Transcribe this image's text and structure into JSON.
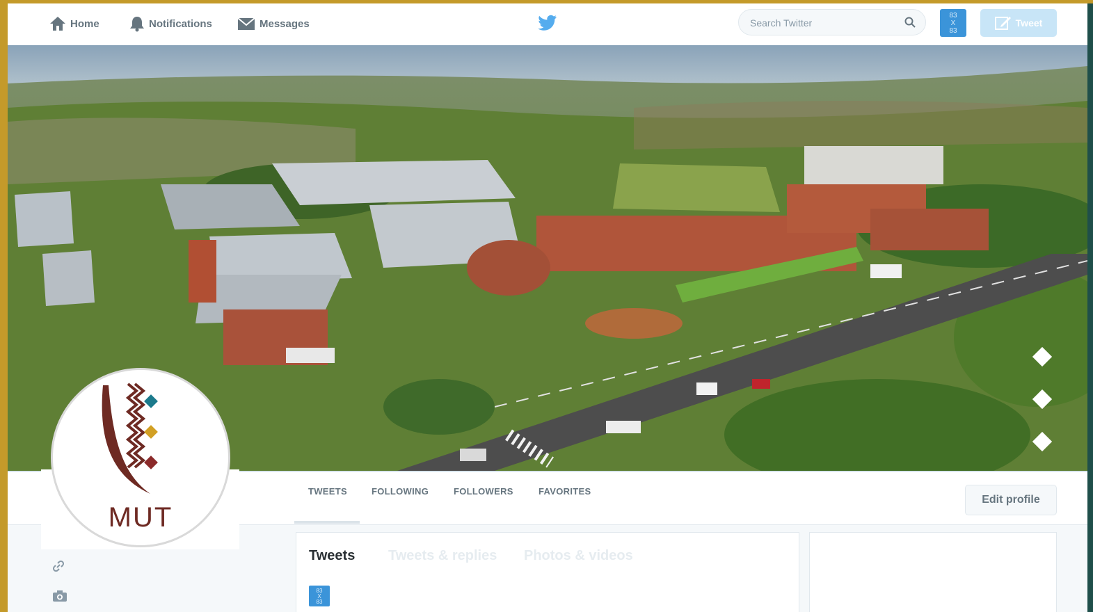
{
  "nav": {
    "home": "Home",
    "notifications": "Notifications",
    "messages": "Messages",
    "search_placeholder": "Search Twitter",
    "avatar_text": [
      "83",
      "X",
      "83"
    ],
    "tweet_button": "Tweet"
  },
  "profile_nav": {
    "tweets": "TWEETS",
    "following": "FOLLOWING",
    "followers": "FOLLOWERS",
    "favorites": "FAVORITES",
    "edit_profile": "Edit profile"
  },
  "logo": {
    "text": "MUT",
    "colors": {
      "brown": "#6e2a23",
      "teal": "#1b7a8c",
      "gold": "#d2a024",
      "maroon": "#8b2a2a"
    }
  },
  "timeline": {
    "tabs": [
      "Tweets",
      "Tweets & replies",
      "Photos & videos"
    ]
  },
  "theme": {
    "twitter_blue": "#55acee",
    "border_gold": "#c49a2a",
    "border_teal": "#1f4f4a"
  }
}
